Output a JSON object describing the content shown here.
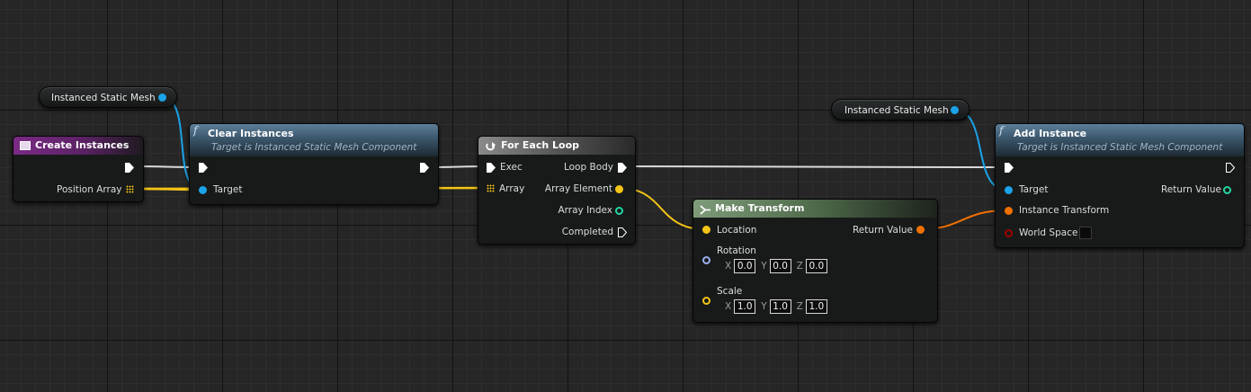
{
  "graph": {
    "nodes": {
      "create_instances": {
        "title": "Create Instances",
        "pin_position_array": "Position Array"
      },
      "clear_instances": {
        "title": "Clear Instances",
        "subtitle": "Target is Instanced Static Mesh Component",
        "pin_target": "Target"
      },
      "for_each_loop": {
        "title": "For Each Loop",
        "pin_exec": "Exec",
        "pin_array": "Array",
        "pin_loop_body": "Loop Body",
        "pin_array_element": "Array Element",
        "pin_array_index": "Array Index",
        "pin_completed": "Completed"
      },
      "make_transform": {
        "title": "Make Transform",
        "pin_location": "Location",
        "pin_return_value": "Return Value",
        "pin_rotation": "Rotation",
        "pin_scale": "Scale",
        "rotation": {
          "x_label": "X",
          "x": "0.0",
          "y_label": "Y",
          "y": "0.0",
          "z_label": "Z",
          "z": "0.0"
        },
        "scale": {
          "x_label": "X",
          "x": "1.0",
          "y_label": "Y",
          "y": "1.0",
          "z_label": "Z",
          "z": "1.0"
        }
      },
      "add_instance": {
        "title": "Add Instance",
        "subtitle": "Target is Instanced Static Mesh Component",
        "pin_target": "Target",
        "pin_instance_transform": "Instance Transform",
        "pin_world_space": "World Space",
        "pin_return_value": "Return Value"
      }
    },
    "variables": {
      "var1": "Instanced Static Mesh",
      "var2": "Instanced Static Mesh"
    }
  },
  "colors": {
    "background": "#262626",
    "exec_wire": "#d9d9d9",
    "object_pin": "#1aa3e8",
    "vector_pin": "#f5c517",
    "transform_pin": "#f07000",
    "int_pin": "#21d7a4",
    "rotator_pin": "#9bb1f0",
    "bool_pin": "#a10000",
    "function_header": "#3a5569",
    "event_header": "#7b2a86",
    "macro_header": "#6b6b6b",
    "struct_header": "#5a7b56"
  },
  "icons": [
    "function-icon",
    "macro-loop-icon",
    "struct-icon",
    "event-icon",
    "exec-pin-icon",
    "array-pin-icon"
  ]
}
